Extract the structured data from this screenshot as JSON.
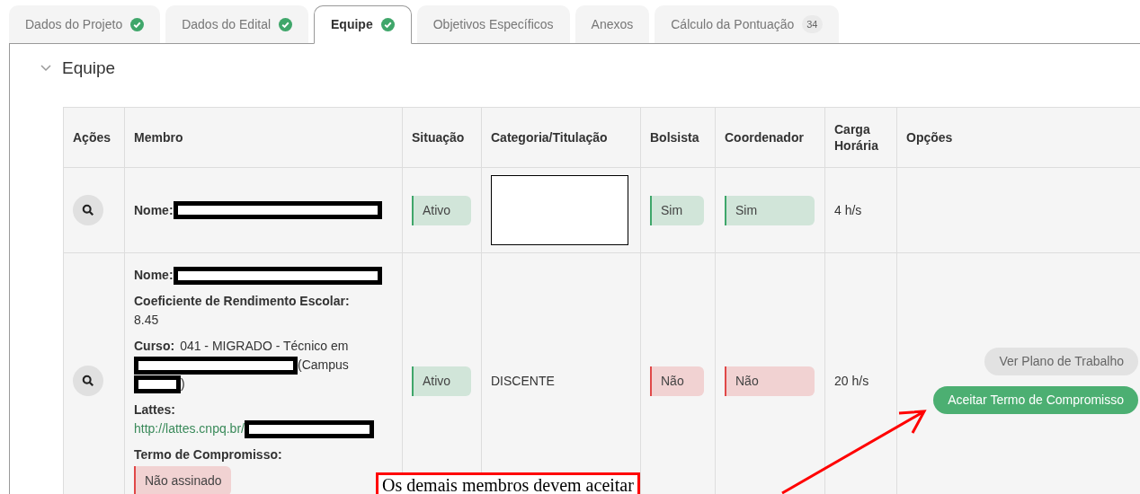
{
  "tabs": [
    {
      "label": "Dados do Projeto",
      "selected": false,
      "done": true
    },
    {
      "label": "Dados do Edital",
      "selected": false,
      "done": true
    },
    {
      "label": "Equipe",
      "selected": true,
      "done": true
    },
    {
      "label": "Objetivos Específicos",
      "selected": false,
      "done": false
    },
    {
      "label": "Anexos",
      "selected": false,
      "done": false
    },
    {
      "label": "Cálculo da Pontuação",
      "selected": false,
      "done": false,
      "badge": "34"
    }
  ],
  "section": {
    "title": "Equipe",
    "expanded": true
  },
  "table": {
    "columns": [
      "Ações",
      "Membro",
      "Situação",
      "Categoria/Titulação",
      "Bolsista",
      "Coordenador",
      "Carga Horária",
      "Opções"
    ],
    "rows": [
      {
        "member": [
          {
            "kind": "name",
            "label": "Nome:"
          }
        ],
        "situacao": {
          "text": "Ativo",
          "color": "#3fa66a"
        },
        "categoria": {
          "kind": "redacted"
        },
        "bolsista": {
          "text": "Sim",
          "color": "#3fa66a"
        },
        "coordenador": {
          "text": "Sim",
          "color": "#3fa66a"
        },
        "carga": "4 h/s",
        "options": []
      },
      {
        "member": [
          {
            "kind": "name",
            "label": "Nome:"
          },
          {
            "kind": "text",
            "label": "Coeficiente de Rendimento Escolar:",
            "value": "8.45"
          },
          {
            "kind": "course",
            "label": "Curso:",
            "value": "041 - MIGRADO - Técnico em",
            "suffix": "(Campus",
            "end": ")"
          },
          {
            "kind": "link",
            "label": "Lattes:",
            "value": "http://lattes.cnpq.br/"
          },
          {
            "kind": "status",
            "label": "Termo de Compromisso:",
            "value": "Não assinado",
            "color": "#e04848"
          }
        ],
        "situacao": {
          "text": "Ativo",
          "color": "#3fa66a"
        },
        "categoria": {
          "kind": "text",
          "text": "DISCENTE"
        },
        "bolsista": {
          "text": "Não",
          "color": "#e04848"
        },
        "coordenador": {
          "text": "Não",
          "color": "#e04848"
        },
        "carga": "20 h/s",
        "options": [
          {
            "label": "Ver Plano de Trabalho",
            "kind": "secondary"
          },
          {
            "label": "Aceitar Termo de Compromisso",
            "kind": "primary"
          }
        ]
      }
    ]
  },
  "annotation": {
    "text": "Os demais membros devem aceitar"
  }
}
